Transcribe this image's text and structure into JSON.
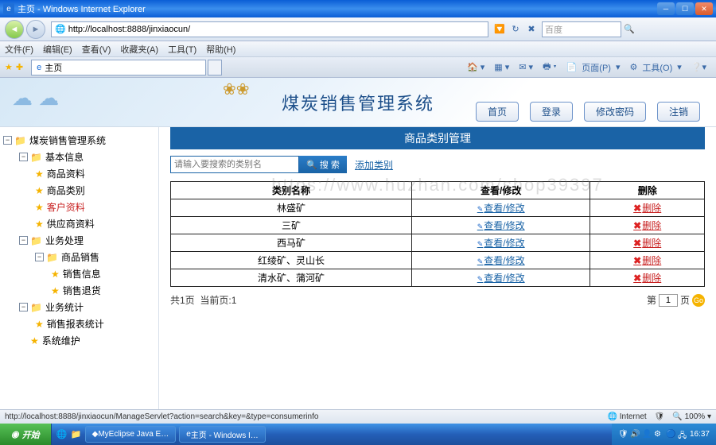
{
  "window": {
    "title": "主页 - Windows Internet Explorer",
    "url": "http://localhost:8888/jinxiaocun/",
    "tab_title": "主页"
  },
  "menus": [
    "文件(F)",
    "编辑(E)",
    "查看(V)",
    "收藏夹(A)",
    "工具(T)",
    "帮助(H)"
  ],
  "search_placeholder": "百度",
  "ie_tools": {
    "page": "页面(P)",
    "tools": "工具(O)"
  },
  "banner": {
    "title": "煤炭销售管理系统"
  },
  "topBtns": [
    "首页",
    "登录",
    "修改密码",
    "注销"
  ],
  "tree": {
    "root": "煤炭销售管理系统",
    "g1": {
      "label": "基本信息",
      "children": [
        "商品资料",
        "商品类别",
        "客户资料",
        "供应商资料"
      ]
    },
    "g2": {
      "label": "业务处理",
      "g2a": {
        "label": "商品销售",
        "children": [
          "销售信息",
          "销售退货"
        ]
      }
    },
    "g3": {
      "label": "业务统计",
      "children": [
        "销售报表统计"
      ]
    },
    "g4": {
      "label": "系统维护"
    }
  },
  "panel": {
    "title": "商品类别管理",
    "search_ph": "请输入要搜索的类别名",
    "search_btn": "搜 索",
    "add_link": "添加类别",
    "headers": [
      "类别名称",
      "查看/修改",
      "删除"
    ],
    "rows": [
      {
        "name": "林盛矿",
        "edit": "查看/修改",
        "del": "删除"
      },
      {
        "name": "三矿",
        "edit": "查看/修改",
        "del": "删除"
      },
      {
        "name": "西马矿",
        "edit": "查看/修改",
        "del": "删除"
      },
      {
        "name": "红绫矿、灵山长",
        "edit": "查看/修改",
        "del": "删除"
      },
      {
        "name": "清水矿、蒲河矿",
        "edit": "查看/修改",
        "del": "删除"
      }
    ],
    "pager": {
      "total": "共1页",
      "current": "当前页:1",
      "goto_prefix": "第",
      "goto_suffix": "页",
      "goto_val": "1"
    }
  },
  "status": {
    "url": "http://localhost:8888/jinxiaocun/ManageServlet?action=search&key=&type=consumerinfo",
    "zone": "Internet",
    "zoom": "100%"
  },
  "task": {
    "start": "开始",
    "apps": [
      "MyEclipse Java E…",
      "主页 - Windows I…"
    ],
    "time": "16:37"
  },
  "watermark": "https://www.huzhan.com/shop39397"
}
